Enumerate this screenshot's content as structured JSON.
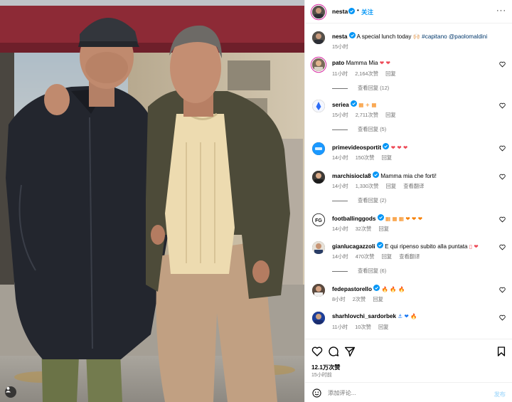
{
  "header": {
    "username": "nesta",
    "follow_label": "关注",
    "more_label": "···"
  },
  "caption": {
    "username": "nesta",
    "text": "A special lunch today 🙌🏻",
    "tags": "#capitano @paolomaldini",
    "time": "15小时"
  },
  "comments": [
    {
      "username": "pato",
      "verified": false,
      "text": "Mamma Mia",
      "emoji": "❤ ❤",
      "emoji_color": "red",
      "time": "11小时",
      "likes": "2,164次赞",
      "reply": "回复",
      "translate": "",
      "replies": "查看回复 (12)"
    },
    {
      "username": "seriea",
      "verified": true,
      "text": "",
      "emoji": "▦ + ▦",
      "emoji_color": "org",
      "time": "15小时",
      "likes": "2,711次赞",
      "reply": "回复",
      "translate": "",
      "replies": "查看回复 (5)"
    },
    {
      "username": "primevideosportit",
      "verified": true,
      "text": "",
      "emoji": "❤ ❤ ❤",
      "emoji_color": "red",
      "time": "14小时",
      "likes": "150次赞",
      "reply": "回复",
      "translate": "",
      "replies": ""
    },
    {
      "username": "marchisiocla8",
      "verified": true,
      "text": "Mamma mia che forti!",
      "emoji": "",
      "emoji_color": "red",
      "time": "14小时",
      "likes": "1,330次赞",
      "reply": "回复",
      "translate": "查看翻译",
      "replies": "查看回复 (2)"
    },
    {
      "username": "footballinggods",
      "verified": true,
      "text": "",
      "emoji": "▦ ▦ ▦ ❤ ❤ ❤",
      "emoji_color": "mixed",
      "time": "14小时",
      "likes": "32次赞",
      "reply": "回复",
      "translate": "",
      "replies": ""
    },
    {
      "username": "gianlucagazzoli",
      "verified": true,
      "text": "E qui ripenso subito alla puntata",
      "emoji": "▯ ❤",
      "emoji_color": "red",
      "time": "14小时",
      "likes": "470次赞",
      "reply": "回复",
      "translate": "查看翻译",
      "replies": "查看回复 (6)"
    },
    {
      "username": "fedepastorello",
      "verified": true,
      "text": "",
      "emoji": "🔥 🔥 🔥",
      "emoji_color": "org",
      "time": "8小时",
      "likes": "2次赞",
      "reply": "回复",
      "translate": "",
      "replies": ""
    },
    {
      "username": "sharhlovchi_sardorbek",
      "verified": false,
      "text": "",
      "emoji": "⚓ ❤ 🔥",
      "emoji_color": "mixed2",
      "time": "11小时",
      "likes": "10次赞",
      "reply": "回复",
      "translate": "",
      "replies": ""
    }
  ],
  "post": {
    "likes": "12.1万次赞",
    "time": "15小时前"
  },
  "comment_box": {
    "placeholder": "添加评论...",
    "post_label": "发布"
  },
  "colors": {
    "link": "#0095f6",
    "verified": "#0095f6",
    "heart": "#ed4956",
    "muted": "#737373"
  },
  "icons": [
    "heart-icon",
    "comment-icon",
    "share-icon",
    "bookmark-icon",
    "emoji-icon",
    "verified-icon",
    "more-icon",
    "user-tag-icon"
  ]
}
